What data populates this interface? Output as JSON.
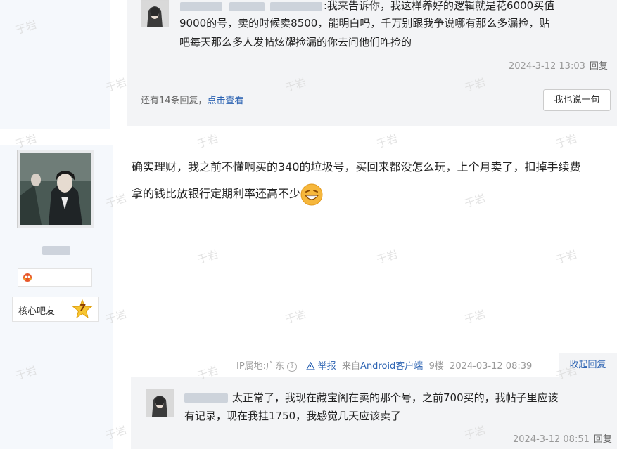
{
  "top_reply": {
    "text_line1": ":我来告诉你，我这样养好的逻辑就是花6000买值",
    "text_line2": "9000的号，卖的时候卖8500，能明白吗，千万别跟我争说哪有那么多漏捡，贴",
    "text_line3": "吧每天那么多人发帖炫耀捡漏的你去问他们咋捡的",
    "timestamp": "2024-3-12 13:03",
    "reply_label": "回复"
  },
  "more_replies": {
    "prefix": "还有14条回复，",
    "link": "点击查看"
  },
  "say_button_label": "我也说一句",
  "user": {
    "rank_label": "核心吧友",
    "level": "7"
  },
  "post": {
    "line1": "确实理财，我之前不懂啊买的340的垃圾号，买回来都没怎么玩，上个月卖了，扣掉手续费",
    "line2": "拿的钱比放银行定期利率还高不少",
    "emoji_icon": "grin-emoji-icon"
  },
  "post_meta": {
    "ip": "IP属地:广东",
    "report": "举报",
    "from_prefix": "来自",
    "client": "Android客户端",
    "floor": "9楼",
    "time": "2024-03-12 08:39"
  },
  "collapse_label": "收起回复",
  "bottom_reply": {
    "text_line1": "太正常了，我现在藏宝阁在卖的那个号，之前700买的，我帖子里应该",
    "text_line2": "有记录，现在我挂1750，我感觉几天应该卖了",
    "timestamp": "2024-3-12 08:51",
    "reply_label": "回复"
  },
  "watermark_text": "于岩",
  "colors": {
    "link_blue": "#2d64b3",
    "reply_bg": "#f3f4f6",
    "sidebar_bg": "#f5f8fc"
  }
}
